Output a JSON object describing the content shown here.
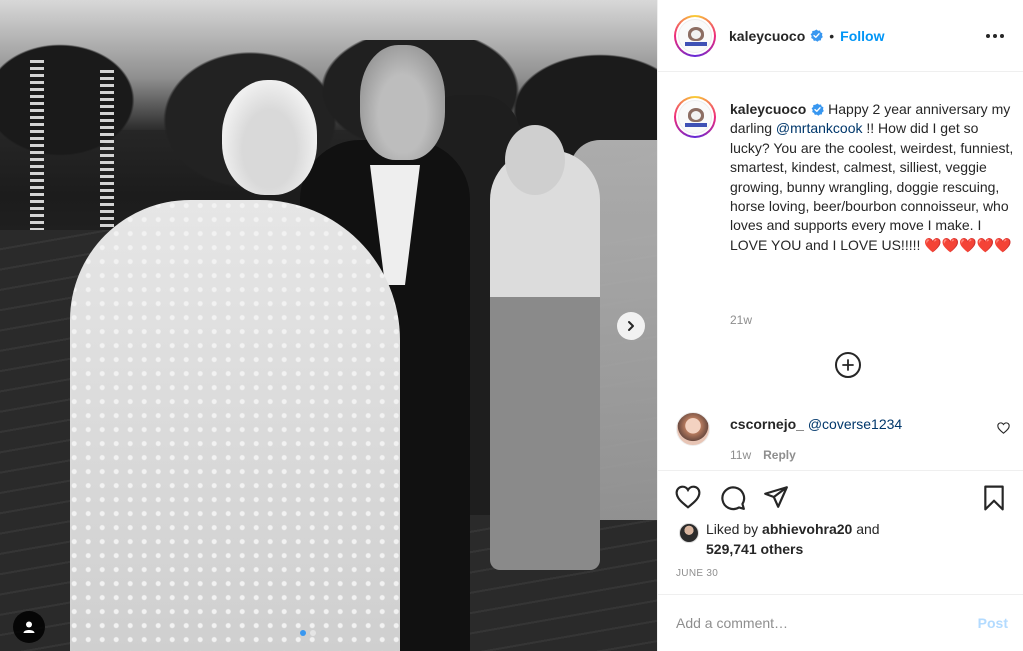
{
  "post": {
    "username": "kaleycuoco",
    "follow_label": "Follow",
    "separator": "•",
    "verified_icon": "verified-badge-icon",
    "brand_blue": "#0095f6"
  },
  "caption": {
    "username": "kaleycuoco",
    "text_before_mention": " Happy 2 year anniversary my darling ",
    "mention": "@mrtankcook",
    "text_after_mention": " !! How did I get so lucky? You are the coolest, weirdest, funniest, smartest, kindest, calmest, silliest, veggie growing, bunny wrangling, doggie rescuing, horse loving, beer/bourbon connoisseur, who loves and supports every move I make. I LOVE YOU and I LOVE US!!!!! ",
    "hearts": "❤️❤️❤️❤️❤️",
    "time": "21w"
  },
  "comments": [
    {
      "username": "cscornejo_",
      "mention": "@coverse1234",
      "time": "11w",
      "reply_label": "Reply"
    }
  ],
  "likes": {
    "prefix": "Liked by ",
    "liker": "abhievohra20",
    "middle": " and",
    "count_text": "529,741 others"
  },
  "date": "JUNE 30",
  "add_comment": {
    "placeholder": "Add a comment…",
    "post_label": "Post"
  }
}
